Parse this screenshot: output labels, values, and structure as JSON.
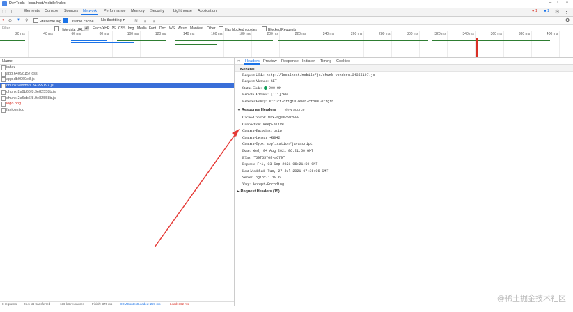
{
  "window": {
    "title": "DevTools - localhost/mobile/index"
  },
  "tabs": [
    "Elements",
    "Console",
    "Sources",
    "Network",
    "Performance",
    "Memory",
    "Security",
    "Lighthouse",
    "Application"
  ],
  "badges": {
    "errors": "1",
    "warnings": "1"
  },
  "toolbar": {
    "preserve_log": "Preserve log",
    "disable_cache": "Disable cache",
    "throttling": "No throttling"
  },
  "filterbar": {
    "filter_placeholder": "Filter",
    "hide_data_urls": "Hide data URLs",
    "types": [
      "All",
      "Fetch/XHR",
      "JS",
      "CSS",
      "Img",
      "Media",
      "Font",
      "Doc",
      "WS",
      "Wasm",
      "Manifest",
      "Other"
    ],
    "blocked_cookies": "Has blocked cookies",
    "blocked_requests": "Blocked Requests"
  },
  "timeline": {
    "ticks": [
      "20 ms",
      "40 ms",
      "60 ms",
      "80 ms",
      "100 ms",
      "120 ms",
      "140 ms",
      "160 ms",
      "180 ms",
      "200 ms",
      "220 ms",
      "240 ms",
      "260 ms",
      "280 ms",
      "300 ms",
      "320 ms",
      "340 ms",
      "360 ms",
      "380 ms",
      "400 ms"
    ]
  },
  "requests": {
    "column_name": "Name",
    "rows": [
      {
        "name": "index",
        "state": "normal"
      },
      {
        "name": "app.6409c157.css",
        "state": "normal"
      },
      {
        "name": "app.db9060e8.js",
        "state": "normal"
      },
      {
        "name": "chunk-vendors.34355197.js",
        "state": "selected"
      },
      {
        "name": "chunk-2a9b66f8.9e82558b.js",
        "state": "normal"
      },
      {
        "name": "chunk-2a6eb6f8.9e82558b.js",
        "state": "normal"
      },
      {
        "name": "logo.png",
        "state": "error"
      },
      {
        "name": "favicon.ico",
        "state": "normal"
      }
    ],
    "status": {
      "requests": "8 requests",
      "transferred": "26.6 kB transferred",
      "resources": "136 kB resources",
      "finish": "Finish: 370 ms",
      "dom": "DOMContentLoaded: 221 ms",
      "load": "Load: 362 ms"
    }
  },
  "detail": {
    "tabs": [
      "Headers",
      "Preview",
      "Response",
      "Initiator",
      "Timing",
      "Cookies"
    ],
    "general": {
      "title": "General",
      "items": [
        {
          "key": "Request URL:",
          "value": "http://localhost/mobile/js/chunk-vendors.34355197.js"
        },
        {
          "key": "Request Method:",
          "value": "GET"
        },
        {
          "key": "Status Code:",
          "value": "200 OK"
        },
        {
          "key": "Remote Address:",
          "value": "[::1]:80"
        },
        {
          "key": "Referrer Policy:",
          "value": "strict-origin-when-cross-origin"
        }
      ]
    },
    "response_headers": {
      "title": "Response Headers",
      "view_source": "view source",
      "items": [
        {
          "key": "Cache-Control:",
          "value": "max-age=2592000"
        },
        {
          "key": "Connection:",
          "value": "keep-alive"
        },
        {
          "key": "Content-Encoding:",
          "value": "gzip"
        },
        {
          "key": "Content-Length:",
          "value": "43042"
        },
        {
          "key": "Content-Type:",
          "value": "application/javascript"
        },
        {
          "key": "Date:",
          "value": "Wed, 04 Aug 2021 06:21:50 GMT"
        },
        {
          "key": "ETag:",
          "value": "\"59f55769-a679\""
        },
        {
          "key": "Expires:",
          "value": "Fri, 03 Sep 2021 06:21:50 GMT"
        },
        {
          "key": "Last-Modified:",
          "value": "Tue, 27 Jul 2021 07:36:06 GMT"
        },
        {
          "key": "Server:",
          "value": "nginx/1.19.6"
        },
        {
          "key": "Vary:",
          "value": "Accept-Encoding"
        }
      ]
    },
    "request_headers": {
      "title": "Request Headers (15)"
    }
  },
  "watermark": "@稀土掘金技术社区",
  "colors": {
    "accent": "#1a73e8",
    "selected_row": "#3a6fd8",
    "arrow": "#e53935",
    "status_ok": "#0f9d58"
  }
}
